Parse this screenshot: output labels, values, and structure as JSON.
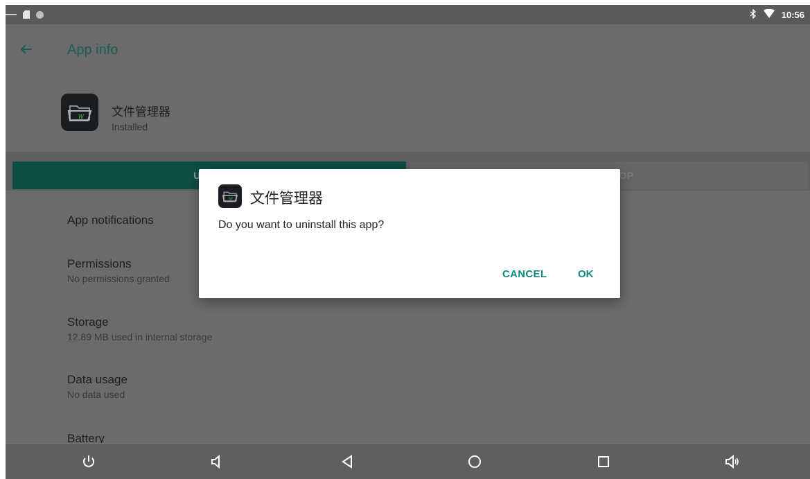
{
  "status_bar": {
    "time": "10:56",
    "left_icons": [
      "minus-icon",
      "sd-card-icon",
      "circle-icon"
    ],
    "right_icons": [
      "bluetooth-icon",
      "wifi-icon"
    ]
  },
  "app_bar": {
    "title": "App info",
    "back_icon": "arrow-left-icon"
  },
  "app_header": {
    "name": "文件管理器",
    "status": "Installed",
    "icon": "file-manager-icon"
  },
  "buttons": {
    "uninstall_label": "UNI",
    "force_stop_label": "TOP"
  },
  "settings_items": [
    {
      "title": "App notifications",
      "subtitle": ""
    },
    {
      "title": "Permissions",
      "subtitle": "No permissions granted"
    },
    {
      "title": "Storage",
      "subtitle": "12.89 MB used in internal storage"
    },
    {
      "title": "Data usage",
      "subtitle": "No data used"
    },
    {
      "title": "Battery",
      "subtitle": ""
    }
  ],
  "dialog": {
    "title": "文件管理器",
    "message": "Do you want to uninstall this app?",
    "cancel_label": "CANCEL",
    "ok_label": "OK"
  },
  "nav_bar": {
    "icons": [
      "power-icon",
      "volume-down-icon",
      "back-triangle-icon",
      "home-circle-icon",
      "recents-square-icon",
      "volume-up-icon"
    ]
  },
  "colors": {
    "accent": "#108a7d",
    "uninstall_button": "#0e4d46",
    "scrim_background": "#6b6b6b"
  }
}
